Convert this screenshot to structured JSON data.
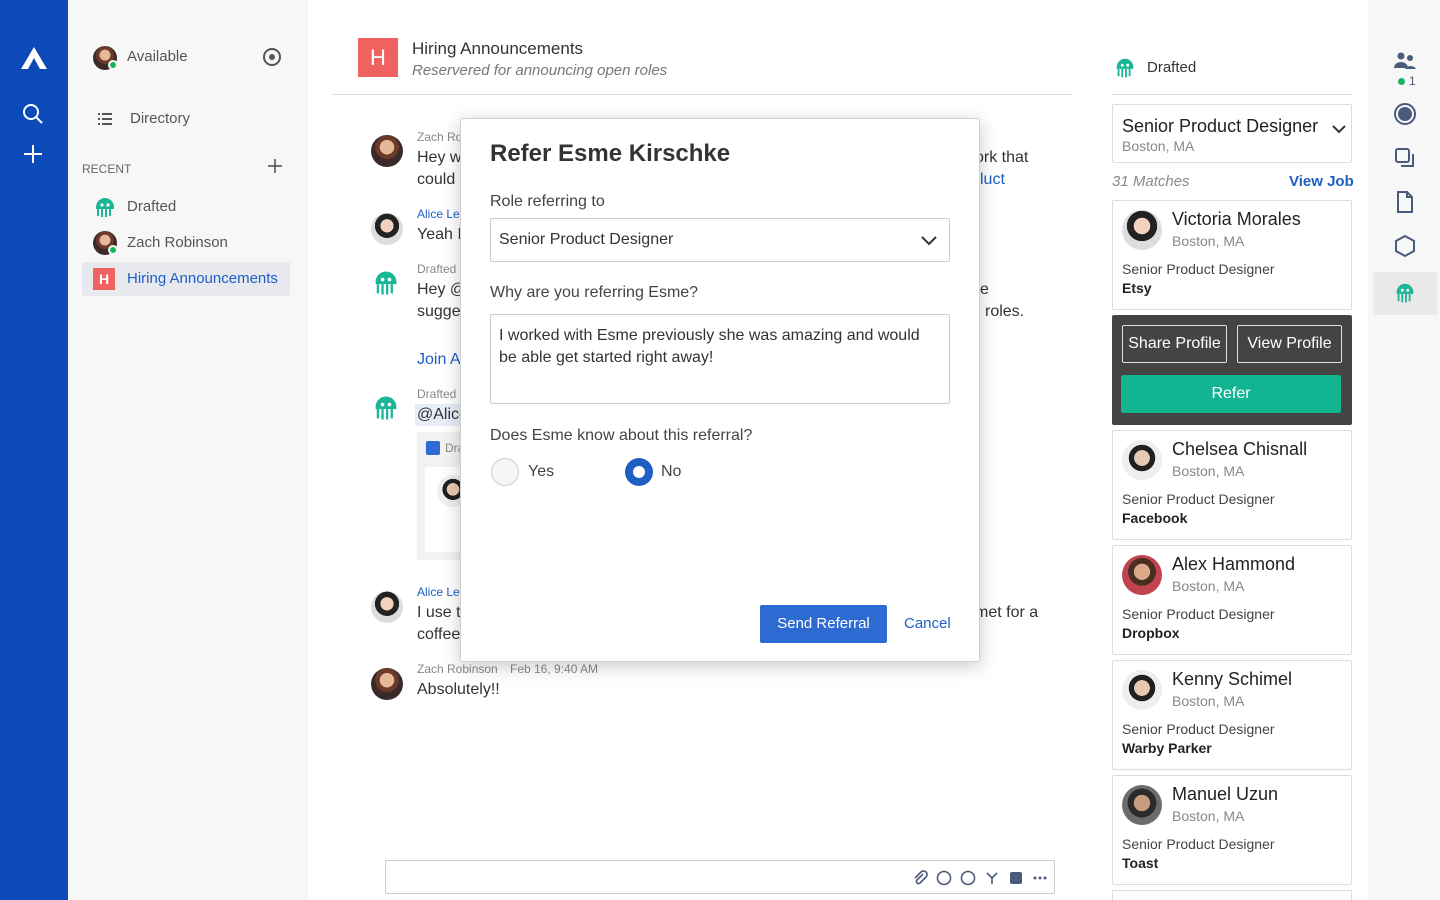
{
  "rail": {
    "logo": "logo-icon",
    "search": "search-icon",
    "add": "plus-icon"
  },
  "sidebar": {
    "status": "Available",
    "directory": "Directory",
    "recent_label": "RECENT",
    "items": [
      {
        "label": "Drafted"
      },
      {
        "label": "Zach Robinson"
      },
      {
        "label": "Hiring Announcements",
        "icon_letter": "H"
      }
    ]
  },
  "channel": {
    "letter": "H",
    "title": "Hiring Announcements",
    "subtitle": "Reservered for announcing open roles"
  },
  "messages": [
    {
      "name": "Zach Ro",
      "line1": "Hey w",
      "line2": "could"
    },
    {
      "name": "Alice Le",
      "line1": "Yeah I"
    },
    {
      "name": "Drafted",
      "line1": "Hey @",
      "line2": "sugge"
    },
    {
      "link": "Join A"
    },
    {
      "name": "Drafted",
      "line1": "@Alice"
    },
    {
      "name": "Alice Le",
      "line1": "I use t",
      "line2": "coffee"
    },
    {
      "name": "Zach Robinson",
      "time": "Feb 16, 9:40 AM",
      "line1": "Absolutely!!"
    }
  ],
  "behind_fragments": {
    "f1": "ork that",
    "f2": "luct",
    "f3": "e",
    "f4": "roles.",
    "f5": "met for a",
    "card": "Dra"
  },
  "modal": {
    "title": "Refer Esme Kirschke",
    "role_label": "Role referring to",
    "role_value": "Senior Product Designer",
    "why_label": "Why are you referring Esme?",
    "why_value": "I worked with Esme previously she was amazing and would be able get started right away!",
    "know_label": "Does Esme know about this referral?",
    "yes": "Yes",
    "no": "No",
    "selected": "No",
    "send": "Send Referral",
    "cancel": "Cancel"
  },
  "right": {
    "header": "Drafted",
    "job_title": "Senior Product Designer",
    "job_location": "Boston, MA",
    "matches": "31 Matches",
    "view_job": "View Job",
    "share_profile": "Share Profile",
    "view_profile": "View Profile",
    "refer": "Refer",
    "candidates": [
      {
        "name": "Victoria Morales",
        "location": "Boston, MA",
        "role": "Senior Product Designer",
        "company": "Etsy"
      },
      {
        "name": "Chelsea Chisnall",
        "location": "Boston, MA",
        "role": "Senior Product Designer",
        "company": "Facebook"
      },
      {
        "name": "Alex Hammond",
        "location": "Boston, MA",
        "role": "Senior Product Designer",
        "company": "Dropbox"
      },
      {
        "name": "Kenny Schimel",
        "location": "Boston, MA",
        "role": "Senior Product Designer",
        "company": "Warby Parker"
      },
      {
        "name": "Manuel Uzun",
        "location": "Boston, MA",
        "role": "Senior Product Designer",
        "company": "Toast"
      }
    ]
  },
  "rrail": {
    "badge": "1"
  },
  "colors": {
    "brand": "#0b4ab8",
    "accent": "#1d5fc4",
    "refer": "#12b591",
    "hiring": "#f0625f"
  }
}
